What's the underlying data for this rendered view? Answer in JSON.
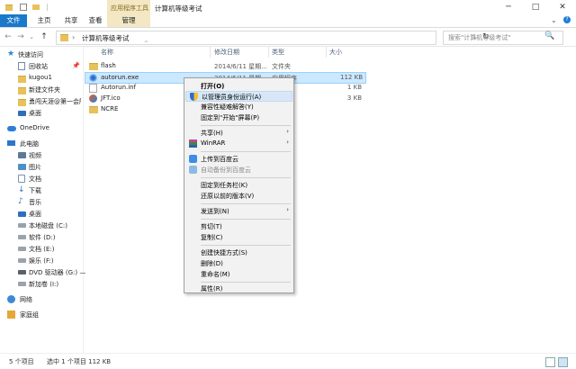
{
  "window": {
    "title": "计算机等级考试",
    "context_tab": "应用程序工具",
    "controls": {
      "minimize": "─",
      "maximize": "□",
      "close": "✕"
    }
  },
  "ribbon": {
    "tabs": [
      {
        "label": "文件",
        "active": true
      },
      {
        "label": "主页"
      },
      {
        "label": "共享"
      },
      {
        "label": "查看"
      },
      {
        "label": "管理",
        "contextual": true
      }
    ],
    "expand_icon": "chevron-down-icon",
    "help_icon": "help-icon"
  },
  "address_bar": {
    "back": "←",
    "forward": "→",
    "recent": "⌄",
    "up": "↑",
    "path": "计算机等级考试",
    "separator": "›",
    "dropdown": "⌄",
    "refresh": "↻",
    "search_placeholder": "搜索\"计算机等级考试\"",
    "search_icon": "🔍"
  },
  "sidebar": {
    "items": [
      {
        "label": "快速访问",
        "icon": "star-icon"
      },
      {
        "label": "回收站",
        "icon": "recycle-bin-icon",
        "pinned": true
      },
      {
        "label": "kugou1",
        "icon": "folder-icon"
      },
      {
        "label": "新建文件夹",
        "icon": "folder-icon"
      },
      {
        "label": "勇闯天涯@第一会所",
        "icon": "folder-icon"
      },
      {
        "label": "桌面",
        "icon": "desktop-icon"
      },
      {
        "label": "OneDrive",
        "icon": "cloud-icon"
      },
      {
        "label": "此电脑",
        "icon": "computer-icon"
      },
      {
        "label": "视频",
        "icon": "video-icon"
      },
      {
        "label": "图片",
        "icon": "pictures-icon"
      },
      {
        "label": "文档",
        "icon": "documents-icon"
      },
      {
        "label": "下载",
        "icon": "downloads-icon"
      },
      {
        "label": "音乐",
        "icon": "music-icon"
      },
      {
        "label": "桌面",
        "icon": "desktop-icon"
      },
      {
        "label": "本地磁盘 (C:)",
        "icon": "drive-icon"
      },
      {
        "label": "软件 (D:)",
        "icon": "drive-icon"
      },
      {
        "label": "文档 (E:)",
        "icon": "drive-icon"
      },
      {
        "label": "娱乐 (F:)",
        "icon": "drive-icon"
      },
      {
        "label": "DVD 驱动器 (G:) —",
        "icon": "dvd-icon"
      },
      {
        "label": "新加卷 (I:)",
        "icon": "drive-icon"
      },
      {
        "label": "网络",
        "icon": "network-icon"
      },
      {
        "label": "家庭组",
        "icon": "homegroup-icon"
      }
    ],
    "pin_glyph": "📌"
  },
  "columns": {
    "name": "名称",
    "date": "修改日期",
    "type": "类型",
    "size": "大小",
    "sort_glyph": "^"
  },
  "files": [
    {
      "name": "flash",
      "date": "2014/6/11 星期...",
      "type": "文件夹",
      "size": "",
      "icon": "folder-icon"
    },
    {
      "name": "autorun.exe",
      "date": "2014/6/11 星期...",
      "type": "应用程序",
      "size": "112 KB",
      "icon": "exe-icon",
      "selected": true
    },
    {
      "name": "Autorun.inf",
      "date": "",
      "type": "",
      "size": "1 KB",
      "icon": "inf-file-icon"
    },
    {
      "name": "JFT.ico",
      "date": "",
      "type": "",
      "size": "3 KB",
      "icon": "ico-file-icon"
    },
    {
      "name": "NCRE",
      "date": "",
      "type": "",
      "size": "",
      "icon": "folder-icon"
    }
  ],
  "context_menu": {
    "items": [
      {
        "label": "打开(O)",
        "bold": true
      },
      {
        "label": "以管理员身份运行(A)",
        "icon": "shield-icon",
        "highlighted": true
      },
      {
        "label": "兼容性疑难解答(Y)"
      },
      {
        "label": "固定到\"开始\"屏幕(P)"
      },
      {
        "separator": true
      },
      {
        "label": "共享(H)",
        "submenu": true
      },
      {
        "label": "WinRAR",
        "icon": "winrar-icon",
        "submenu": true
      },
      {
        "separator": true
      },
      {
        "label": "上传到百度云",
        "icon": "baidu-cloud-icon"
      },
      {
        "label": "自动备份到百度云",
        "icon": "baidu-cloud-icon",
        "disabled": true
      },
      {
        "separator": true
      },
      {
        "label": "固定到任务栏(K)"
      },
      {
        "label": "还原以前的版本(V)"
      },
      {
        "separator": true
      },
      {
        "label": "发送到(N)",
        "submenu": true
      },
      {
        "separator": true
      },
      {
        "label": "剪切(T)"
      },
      {
        "label": "复制(C)"
      },
      {
        "separator": true
      },
      {
        "label": "创建快捷方式(S)"
      },
      {
        "label": "删除(D)"
      },
      {
        "label": "重命名(M)"
      },
      {
        "separator": true
      },
      {
        "label": "属性(R)"
      }
    ],
    "submenu_glyph": "›"
  },
  "status_bar": {
    "item_count": "5 个项目",
    "selection": "选中 1 个项目  112 KB"
  }
}
